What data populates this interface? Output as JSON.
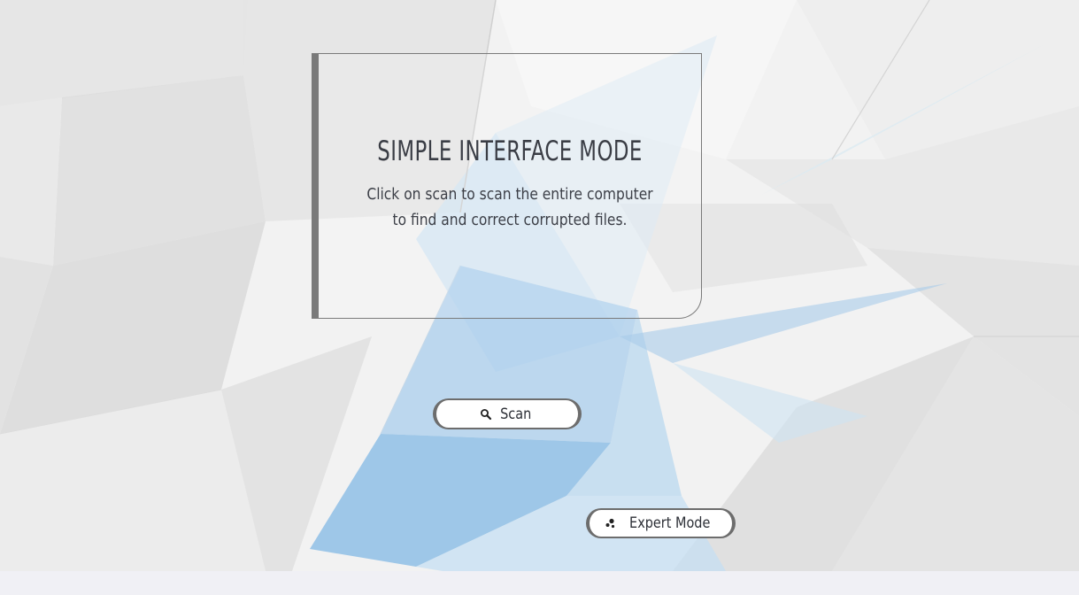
{
  "card": {
    "title": "SIMPLE INTERFACE MODE",
    "description": "Click on scan to scan the entire computer to find and correct corrupted files."
  },
  "buttons": {
    "scan": {
      "label": "Scan",
      "icon": "search-icon"
    },
    "expert": {
      "label": "Expert Mode",
      "icon": "dots-icon"
    }
  },
  "colors": {
    "border": "#7a7a7a",
    "text": "#3a3d45",
    "accent_blue": "#8fbfe6"
  }
}
